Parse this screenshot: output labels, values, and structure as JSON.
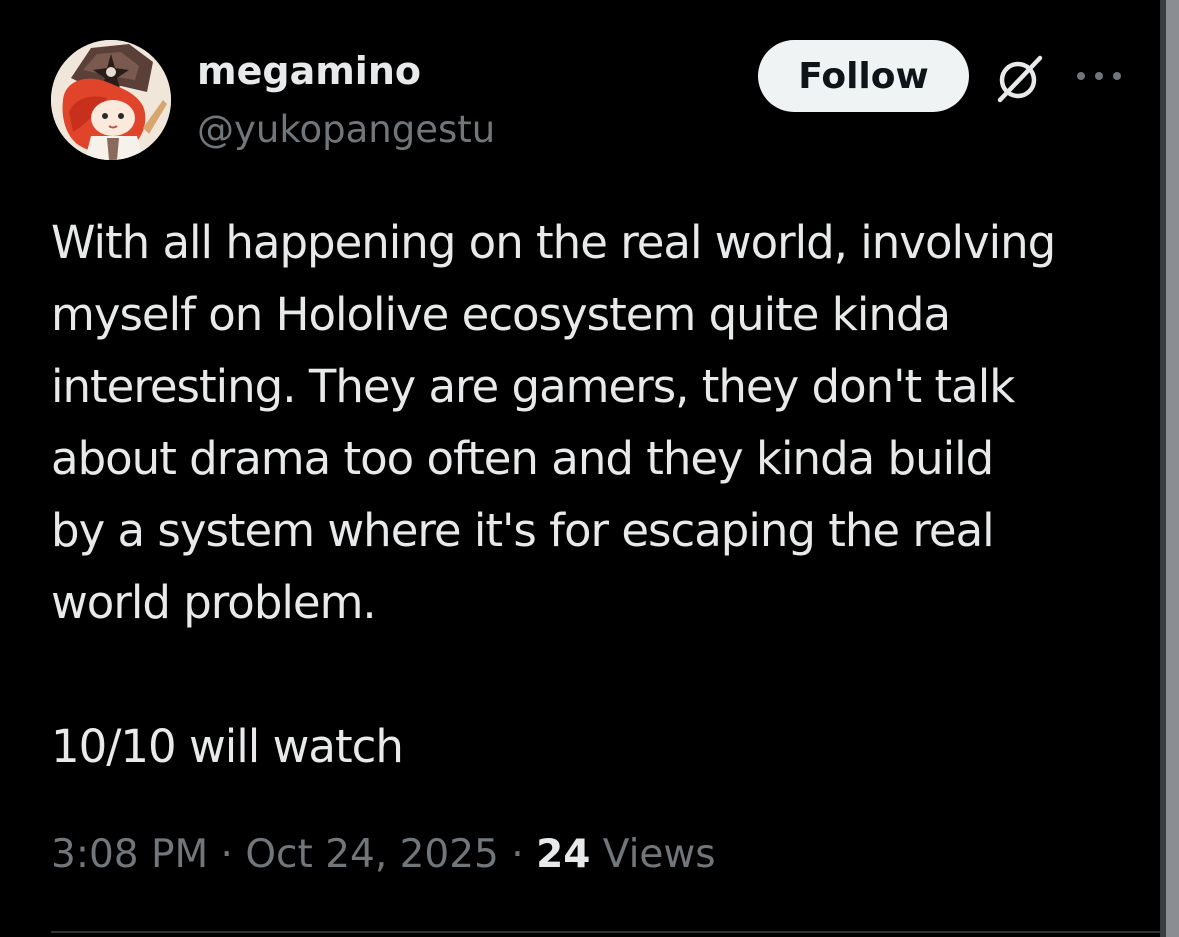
{
  "author": {
    "display_name": "megamino",
    "handle": "@yukopangestu"
  },
  "actions": {
    "follow_label": "Follow"
  },
  "icons": {
    "grok": "grok-icon",
    "more": "more-dots-icon",
    "avatar": "avatar-image"
  },
  "post": {
    "text": "With all happening on the real world, involving\nmyself on Hololive ecosystem quite kinda\ninteresting. They are gamers, they don't talk\nabout drama too often and they kinda build\nby a system where it's for escaping the real\nworld problem.\n\n10/10 will watch",
    "time": "3:08 PM",
    "separator": " · ",
    "date": "Oct 24, 2025",
    "views_count": "24",
    "views_label": "Views"
  },
  "colors": {
    "background": "#000000",
    "primary_text": "#e7e9ea",
    "secondary_text": "#71767b",
    "follow_button_bg": "#eff3f4",
    "follow_button_text": "#0f1419",
    "divider": "#2f3336"
  }
}
